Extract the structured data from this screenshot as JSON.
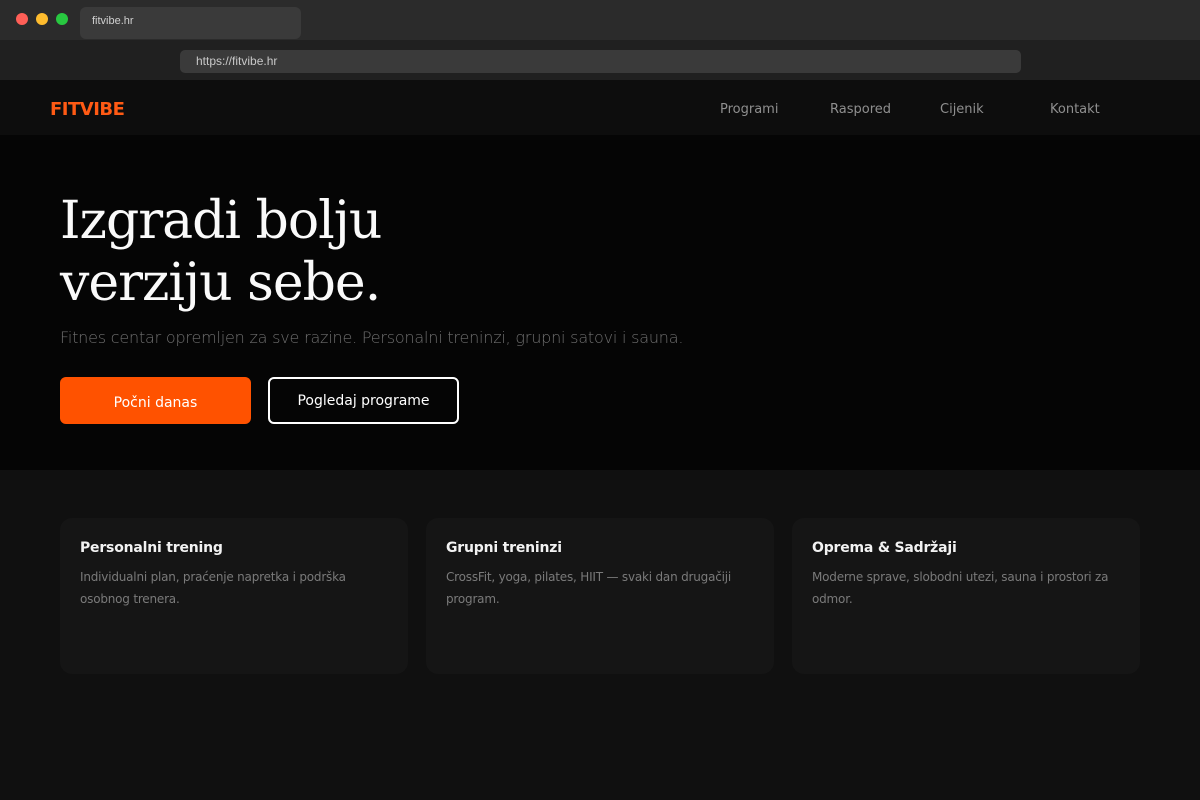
{
  "browser": {
    "tab_title": "fitvibe.hr",
    "url": "https://fitvibe.hr"
  },
  "nav": {
    "logo": "FITVIBE",
    "links": [
      "Programi",
      "Raspored",
      "Cijenik",
      "Kontakt"
    ]
  },
  "hero": {
    "title_line1": "Izgradi bolju",
    "title_line2": "verziju sebe.",
    "subtitle": "Fitnes centar opremljen za sve razine. Personalni treninzi, grupni satovi i sauna.",
    "primary_cta": "Počni danas",
    "secondary_cta": "Pogledaj programe"
  },
  "features": [
    {
      "title": "Personalni trening",
      "text": "Individualni plan, praćenje napretka i podrška osobnog trenera."
    },
    {
      "title": "Grupni treninzi",
      "text": "CrossFit, yoga, pilates, HIIT — svaki dan drugačiji program."
    },
    {
      "title": "Oprema & Sadržaji",
      "text": "Moderne sprave, slobodni utezi, sauna i prostori za odmor."
    }
  ],
  "colors": {
    "accent": "#ff5200",
    "logo": "#ff5a14",
    "background": "#101010",
    "hero_background": "#050505"
  }
}
